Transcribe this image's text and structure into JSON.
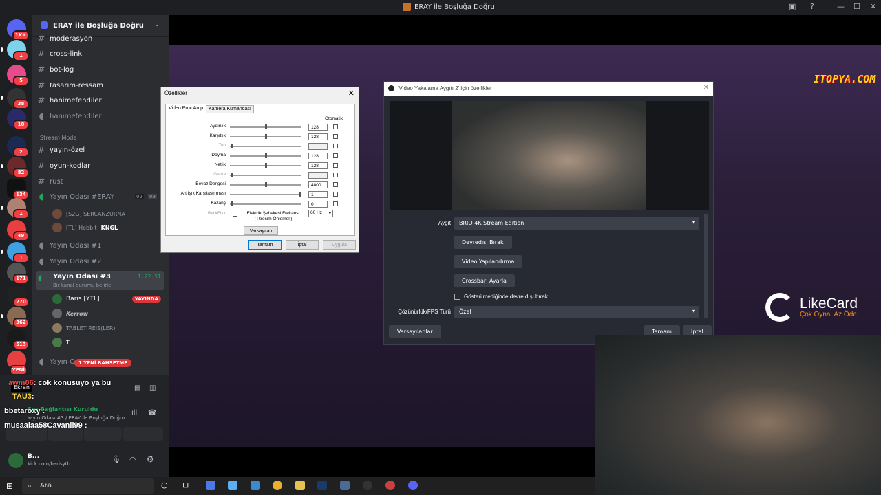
{
  "window": {
    "title": "ERAY ile Boşluğa Doğru"
  },
  "server": {
    "name": "ERAY ile Boşluğa Doğru"
  },
  "rail": [
    {
      "badge": "1K+"
    },
    {
      "badge": "1"
    },
    {
      "badge": "5"
    },
    {
      "badge": "38"
    },
    {
      "badge": "10"
    },
    {
      "badge": "2"
    },
    {
      "badge": "82"
    },
    {
      "badge": "134"
    },
    {
      "badge": "1"
    },
    {
      "badge": "49"
    },
    {
      "badge": "1"
    },
    {
      "badge": "171"
    },
    {
      "badge": "270"
    },
    {
      "badge": "362"
    },
    {
      "badge": "513"
    },
    {
      "badge": "YENİ"
    }
  ],
  "channels": {
    "text": [
      "moderasyon",
      "cross-link",
      "bot-log",
      "tasarım-ressam",
      "hanimefendiler",
      "hanımefendiler"
    ],
    "category": "Stream Mode",
    "stream": [
      "yayın-özel",
      "oyun-kodlar",
      "rust"
    ],
    "voice_main": {
      "name": "Yayın Odası #ERAY",
      "count_a": "02",
      "count_b": "99"
    },
    "voice_users": [
      "[S2G] SERCANZURNA",
      "[TL] Hobbit",
      "KNGL"
    ],
    "voice_others": [
      "Yayın Odası #1",
      "Yayın Odası #2"
    ],
    "active_voice": {
      "name": "Yayın Odası #3",
      "timer": "1:22:51",
      "status": "Bir kanal durumu belirle"
    },
    "active_users": [
      "Baris [YTL]",
      "Kerrow",
      "TABLET REIS(LER)",
      "T..."
    ],
    "live_label": "YAYINDA",
    "next_voice": "Yayın O",
    "mention_badge": "1 YENİ BAHSETME"
  },
  "voice_panel": {
    "screen_label": "Ekran",
    "connected": "Ses Bağlantısı Kuruldu",
    "location": "Yayın Odası #3 / ERAY ile Boşluğa Doğru",
    "user_name": "B...",
    "user_status": "kick.com/barisytb"
  },
  "chat_overlay": [
    {
      "user": "awm06",
      "msg": ": cok konusuyo ya bu"
    },
    {
      "user": "TAU3",
      "msg": ":"
    },
    {
      "user": "bbetaroxy",
      "msg": ":"
    },
    {
      "user": "musaalaa58Cavanii99",
      "msg": ":"
    }
  ],
  "props": {
    "title": "Özellikler",
    "tabs": [
      "Video Proc Amp",
      "Kamera Kumandası"
    ],
    "auto_label": "Otomatik",
    "rows": [
      {
        "label": "Aydınlık",
        "value": "128",
        "pos": 0.5
      },
      {
        "label": "Karşıtlık",
        "value": "128",
        "pos": 0.5
      },
      {
        "label": "Ton",
        "value": "",
        "pos": 0
      },
      {
        "label": "Doyma",
        "value": "128",
        "pos": 0.5
      },
      {
        "label": "Netlik",
        "value": "128",
        "pos": 0.5
      },
      {
        "label": "Gama",
        "value": "",
        "pos": 0
      },
      {
        "label": "Beyaz Dengesi",
        "value": "4800",
        "pos": 0.5
      },
      {
        "label": "Art Işık Karşılaştırması",
        "value": "1",
        "pos": 1
      },
      {
        "label": "Kazanç",
        "value": "0",
        "pos": 0
      }
    ],
    "renk_label": "RenkEtkin",
    "freq_label": "Elektrik Şebekesi Frekansı (Titreşim Önlemeli)",
    "freq_value": "60 Hz",
    "defaults": "Varsayılan",
    "ok": "Tamam",
    "cancel": "İptal",
    "apply": "Uygula"
  },
  "obs": {
    "title": "'Video Yakalama Aygıtı 2' için özellikler",
    "device_label": "Aygıt",
    "device_value": "BRIO 4K Stream Edition",
    "btn_disable": "Devredışı Bırak",
    "btn_config": "Video Yapılandırma",
    "btn_crossbar": "Crossbarı Ayarla",
    "hide_check": "Gösterilmediğinde devre dışı bırak",
    "res_label": "Çözünürlük/FPS Türü",
    "res_value": "Özel",
    "defaults": "Varsayılanlar",
    "ok": "Tamam",
    "cancel": "İptal"
  },
  "overlays": {
    "itopya": "ITOPYA.COM",
    "likecard": "LikeCard",
    "likecard_sub": "Çok Oyna  Az Öde"
  },
  "taskbar": {
    "search_placeholder": "Ara"
  },
  "colors": {
    "accent": "#5865f2",
    "live": "#da373c",
    "obs_bg": "#272a33"
  }
}
